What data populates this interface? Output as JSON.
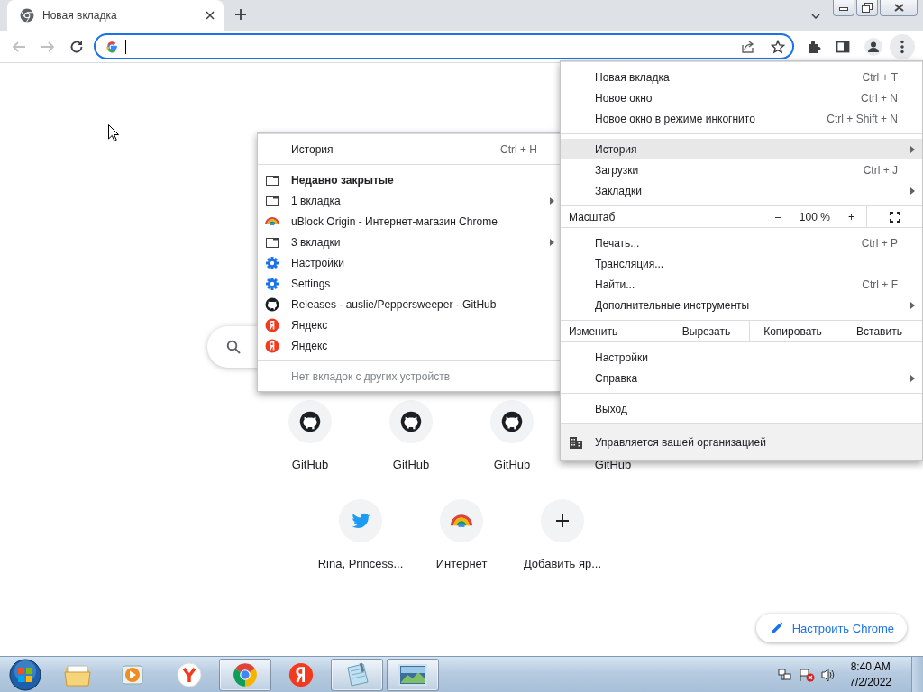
{
  "tabs": [
    {
      "title": "Новая вкладка",
      "selected": true
    }
  ],
  "main_menu": {
    "sections": [
      {
        "items": [
          {
            "kind": "item",
            "label": "Новая вкладка",
            "shortcut": "Ctrl + T",
            "submenu": false,
            "selected": false
          },
          {
            "kind": "item",
            "label": "Новое окно",
            "shortcut": "Ctrl + N",
            "submenu": false,
            "selected": false
          },
          {
            "kind": "item",
            "label": "Новое окно в режиме инкогнито",
            "shortcut": "Ctrl + Shift + N",
            "submenu": false,
            "selected": false
          }
        ]
      },
      {
        "items": [
          {
            "kind": "item",
            "label": "История",
            "submenu": true,
            "selected": true
          },
          {
            "kind": "item",
            "label": "Загрузки",
            "shortcut": "Ctrl + J",
            "submenu": false,
            "selected": false
          },
          {
            "kind": "item",
            "label": "Закладки",
            "submenu": true,
            "selected": false
          }
        ]
      },
      {
        "items": [
          {
            "kind": "zoom",
            "label": "Масштаб",
            "minus": "–",
            "value": "100 %",
            "plus": "+"
          }
        ]
      },
      {
        "items": [
          {
            "kind": "item",
            "label": "Печать...",
            "shortcut": "Ctrl + P",
            "submenu": false,
            "selected": false
          },
          {
            "kind": "item",
            "label": "Трансляция...",
            "submenu": false,
            "selected": false
          },
          {
            "kind": "item",
            "label": "Найти...",
            "shortcut": "Ctrl + F",
            "submenu": false,
            "selected": false
          },
          {
            "kind": "item",
            "label": "Дополнительные инструменты",
            "submenu": true,
            "selected": false
          }
        ]
      },
      {
        "items": [
          {
            "kind": "edit",
            "label": "Изменить",
            "buttons": [
              "Вырезать",
              "Копировать",
              "Вставить"
            ]
          }
        ]
      },
      {
        "items": [
          {
            "kind": "item",
            "label": "Настройки",
            "submenu": false,
            "selected": false
          },
          {
            "kind": "item",
            "label": "Справка",
            "submenu": true,
            "selected": false
          }
        ]
      },
      {
        "items": [
          {
            "kind": "item",
            "label": "Выход",
            "submenu": false,
            "selected": false
          }
        ]
      },
      {
        "items": [
          {
            "kind": "managed",
            "label": "Управляется вашей организацией"
          }
        ]
      }
    ]
  },
  "history_menu": {
    "sections": [
      {
        "items": [
          {
            "kind": "plain",
            "label": "История",
            "shortcut": "Ctrl + H",
            "submenu": false,
            "selected": false
          }
        ]
      },
      {
        "items": [
          {
            "kind": "heading",
            "label": "Недавно закрытые",
            "submenu": false,
            "selected": false
          },
          {
            "kind": "window",
            "label": "1 вкладка",
            "submenu": true,
            "selected": false
          },
          {
            "kind": "store",
            "label": "uBlock Origin - Интернет-магазин Chrome",
            "submenu": false,
            "selected": false
          },
          {
            "kind": "window",
            "label": "3 вкладки",
            "submenu": true,
            "selected": false
          },
          {
            "kind": "settings",
            "label": "Настройки",
            "submenu": false,
            "selected": false
          },
          {
            "kind": "settings",
            "label": "Settings",
            "submenu": false,
            "selected": false
          },
          {
            "kind": "github",
            "label": "Releases · auslie/Peppersweeper · GitHub",
            "submenu": false,
            "selected": false
          },
          {
            "kind": "yandex",
            "label": "Яндекс",
            "submenu": false,
            "selected": false
          },
          {
            "kind": "yandex",
            "label": "Яндекс",
            "submenu": false,
            "selected": false
          }
        ]
      },
      {
        "items": [
          {
            "kind": "note",
            "label": "Нет вкладок с других устройств",
            "submenu": false,
            "selected": false
          }
        ]
      }
    ]
  },
  "shortcut_rows": [
    {
      "tiles": [
        {
          "kind": "github",
          "title": "GitHub"
        },
        {
          "kind": "github",
          "title": "GitHub"
        },
        {
          "kind": "github",
          "title": "GitHub"
        },
        {
          "kind": "covered",
          "title": "GitHub"
        }
      ]
    },
    {
      "tiles": [
        {
          "kind": "twitter",
          "title": "Rina, Princess..."
        },
        {
          "kind": "store",
          "title": "Интернет"
        },
        {
          "kind": "add",
          "title": "Добавить яр..."
        }
      ]
    }
  ],
  "customize_button": "Настроить Chrome",
  "taskbar": {
    "items": [
      {
        "kind": "explorer",
        "running": false
      },
      {
        "kind": "media",
        "running": false
      },
      {
        "kind": "yandex-browser",
        "running": false
      },
      {
        "kind": "chrome",
        "running": true
      },
      {
        "kind": "yandex",
        "running": false
      },
      {
        "kind": "notepad",
        "running": true
      },
      {
        "kind": "photos",
        "running": true
      }
    ],
    "clock": {
      "time": "8:40 AM",
      "date": "7/2/2022"
    }
  }
}
